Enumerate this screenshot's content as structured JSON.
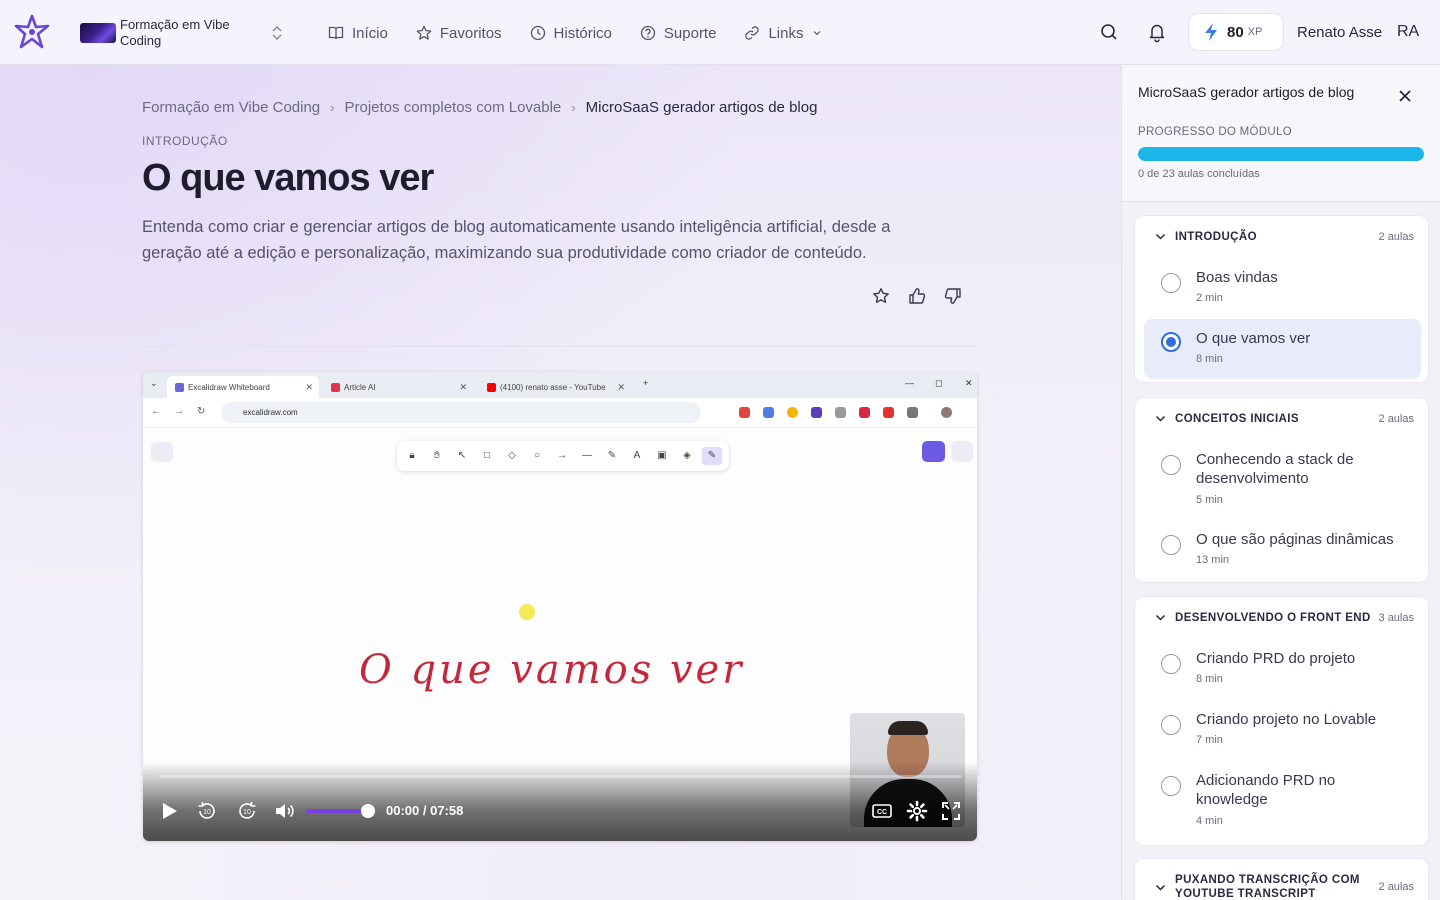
{
  "header": {
    "course": {
      "name": "Formação em Vibe Coding"
    },
    "nav": [
      {
        "label": "Início",
        "icon": "book-icon"
      },
      {
        "label": "Favoritos",
        "icon": "star-icon"
      },
      {
        "label": "Histórico",
        "icon": "clock-icon"
      },
      {
        "label": "Suporte",
        "icon": "help-circle-icon"
      },
      {
        "label": "Links",
        "icon": "link-icon"
      }
    ],
    "xp": {
      "value": "80",
      "unit": "XP"
    },
    "user": {
      "name": "Renato Asse",
      "initials": "RA"
    }
  },
  "breadcrumb": [
    "Formação em Vibe Coding",
    "Projetos completos com Lovable",
    "MicroSaaS gerador artigos de blog"
  ],
  "lesson": {
    "section": "INTRODUÇÃO",
    "title": "O que vamos ver",
    "description": "Entenda como criar e gerenciar artigos de blog automaticamente usando inteligência artificial, desde a geração até a edição e personalização, maximizando sua produtividade como criador de conteúdo."
  },
  "video": {
    "browser_tabs": [
      {
        "label": "Excalidraw Whiteboard",
        "color": "#6965db"
      },
      {
        "label": "Article AI",
        "color": "#e2344a"
      },
      {
        "label": "(4100) renato asse - YouTube",
        "color": "#ff0000"
      }
    ],
    "url": "excalidraw.com",
    "whiteboard_text": "O que vamos ver",
    "time": "00:00 / 07:58",
    "skip_seconds": "10",
    "progress": 0,
    "volume": 0.9,
    "accent": "#7b3fe4"
  },
  "sidebar": {
    "title": "MicroSaaS gerador artigos de blog",
    "progress_label": "PROGRESSO DO MÓDULO",
    "progress_text": "0 de 23 aulas concluídas",
    "progress_fill": 1.0,
    "progress_color": "#1cb6e9",
    "modules": [
      {
        "title": "INTRODUÇÃO",
        "count": "2 aulas",
        "lessons": [
          {
            "title": "Boas vindas",
            "duration": "2 min"
          },
          {
            "title": "O que vamos ver",
            "duration": "8 min",
            "active": true
          }
        ]
      },
      {
        "title": "CONCEITOS INICIAIS",
        "count": "2 aulas",
        "lessons": [
          {
            "title": "Conhecendo a stack de desenvolvimento",
            "duration": "5 min"
          },
          {
            "title": "O que são páginas dinâmicas",
            "duration": "13 min"
          }
        ]
      },
      {
        "title": "DESENVOLVENDO O FRONT END",
        "count": "3 aulas",
        "lessons": [
          {
            "title": "Criando PRD do projeto",
            "duration": "8 min"
          },
          {
            "title": "Criando projeto no Lovable",
            "duration": "7 min"
          },
          {
            "title": "Adicionando PRD no knowledge",
            "duration": "4 min"
          }
        ]
      },
      {
        "title": "PUXANDO TRANSCRIÇÃO COM YOUTUBE TRANSCRIPT",
        "count": "2 aulas",
        "lessons": []
      }
    ]
  }
}
